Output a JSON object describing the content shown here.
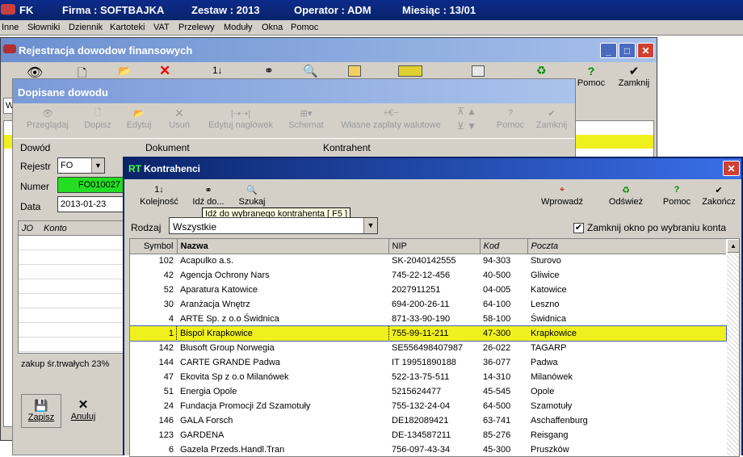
{
  "app": {
    "name": "FK",
    "firma": "Firma : SOFTBAJKA",
    "zestaw": "Zestaw : 2013",
    "operator": "Operator : ADM",
    "miesiac": "Miesiąc : 13/01"
  },
  "menu": [
    "Inne",
    "Słowniki",
    "Dziennik",
    "Kartoteki",
    "VAT",
    "Przelewy",
    "Moduły",
    "Okna",
    "Pomoc"
  ],
  "reg_window": {
    "title": "Rejestracja dowodow finansowych",
    "pomoc": "Pomoc",
    "zamknij": "Zamknij"
  },
  "dop_window": {
    "title": "Dopisane dowodu",
    "toolbar": [
      "Przeglądaj",
      "Dopisz",
      "Edytuj",
      "Usuń",
      "Edytuj nagłówek",
      "Schemat",
      "Własne zapłaty walutowe",
      "Pomoc",
      "Zamknij"
    ],
    "col_dowod": "Dowód",
    "col_dokument": "Dokument",
    "col_kontrahent": "Kontrahent",
    "rejestr_label": "Rejestr",
    "rejestr_value": "FO",
    "numer_label": "Numer",
    "numer_value": "FO010027",
    "data_label": "Data",
    "data_value": "2013-01-23",
    "jo_header": "JO",
    "konto_header": "Konto",
    "status_text": "zakup śr.trwałych 23%",
    "zapisz": "Zapisz",
    "anuluj": "Anuluj"
  },
  "kon_window": {
    "title_badge": "RT",
    "title": "Kontrahenci",
    "kolejnosc": "Kolejność",
    "idz": "Idź do...",
    "szukaj": "Szukaj",
    "tooltip": "Idź do wybranego kontrahenta [ F5 ]",
    "wprowadz": "Wprowadź",
    "odswiez": "Odśwież",
    "pomoc": "Pomoc",
    "zakoncz": "Zakończ",
    "rodzaj_label": "Rodzaj",
    "rodzaj_value": "Wszystkie",
    "zamknij_label": "Zamknij okno po wybraniu konta",
    "zamknij_checked": true,
    "headers": [
      "Symbol",
      "Nazwa",
      "NIP",
      "Kod",
      "Poczta"
    ],
    "rows": [
      [
        "102",
        "Acapulko  a.s.",
        "SK-2040142555",
        "94-303",
        "Sturovo"
      ],
      [
        "42",
        "Agencja Ochrony Nars",
        "745-22-12-456",
        "40-500",
        "Gliwice"
      ],
      [
        "52",
        "Aparatura Katowice",
        "2027911251",
        "04-005",
        "Katowice"
      ],
      [
        "30",
        "Aranżacja Wnętrz",
        "694-200-26-11",
        "64-100",
        "Leszno"
      ],
      [
        "4",
        "ARTE Sp. z o.o Świdnica",
        "871-33-90-190",
        "58-100",
        "Świdnica"
      ],
      [
        "1",
        "Bispol Krapkowice",
        "755-99-11-211",
        "47-300",
        "Krapkowice"
      ],
      [
        "142",
        "Blusoft Group  Norwegia",
        "SE556498407987",
        "26-022",
        "TAGARP"
      ],
      [
        "144",
        "CARTE GRANDE Padwa",
        "IT 19951890188",
        "36-077",
        "Padwa"
      ],
      [
        "47",
        "Ekovita Sp z o.o Milanówek",
        "522-13-75-511",
        "14-310",
        "Milanówek"
      ],
      [
        "51",
        "Energia Opole",
        "5215624477",
        "45-545",
        "Opole"
      ],
      [
        "24",
        "Fundacja Promocji Zd Szamotuły",
        "755-132-24-04",
        "64-500",
        "Szamotuły"
      ],
      [
        "146",
        "GALA  Forsch",
        "DE182089421",
        "63-741",
        "Aschaffenburg"
      ],
      [
        "123",
        "GARDENA",
        "DE-134587211",
        "85-276",
        "Reisgang"
      ],
      [
        "6",
        "Gazela  Przeds.Handl.Tran",
        "756-097-43-34",
        "45-300",
        "Pruszków"
      ]
    ],
    "selected_row": 5
  },
  "colors": {
    "accent": "#0a246a",
    "highlight": "#f0f01e",
    "numer_bg": "#22dd22"
  }
}
